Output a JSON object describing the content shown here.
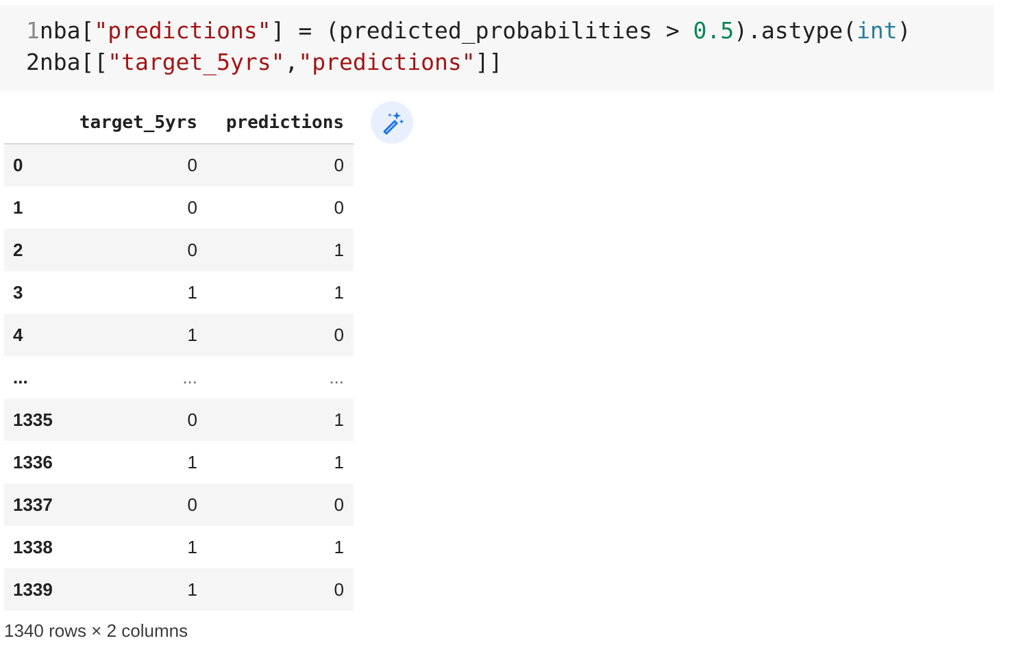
{
  "code": {
    "line1": {
      "number": "1",
      "tokens": {
        "a": "nba[",
        "b": "\"predictions\"",
        "c": "] = (predicted_probabilities > ",
        "d": "0.5",
        "e": ").astype(",
        "f": "int",
        "g": ")"
      }
    },
    "line2": {
      "number": "2",
      "tokens": {
        "a": "nba[[",
        "b": "\"target_5yrs\"",
        "c": ",",
        "d": "\"predictions\"",
        "e": "]]"
      }
    }
  },
  "dataframe": {
    "columns": [
      "target_5yrs",
      "predictions"
    ],
    "rows": [
      {
        "index": "0",
        "values": [
          "0",
          "0"
        ]
      },
      {
        "index": "1",
        "values": [
          "0",
          "0"
        ]
      },
      {
        "index": "2",
        "values": [
          "0",
          "1"
        ]
      },
      {
        "index": "3",
        "values": [
          "1",
          "1"
        ]
      },
      {
        "index": "4",
        "values": [
          "1",
          "0"
        ]
      },
      {
        "index": "...",
        "values": [
          "...",
          "..."
        ]
      },
      {
        "index": "1335",
        "values": [
          "0",
          "1"
        ]
      },
      {
        "index": "1336",
        "values": [
          "1",
          "1"
        ]
      },
      {
        "index": "1337",
        "values": [
          "0",
          "0"
        ]
      },
      {
        "index": "1338",
        "values": [
          "1",
          "1"
        ]
      },
      {
        "index": "1339",
        "values": [
          "1",
          "0"
        ]
      }
    ],
    "shape_text": "1340 rows × 2 columns"
  },
  "icons": {
    "wand": "magic-wand-icon"
  },
  "colors": {
    "string": "#a31515",
    "number": "#098658",
    "builtin": "#267f99",
    "wand": "#1a73e8",
    "wand_bg": "#e8f0fe"
  }
}
